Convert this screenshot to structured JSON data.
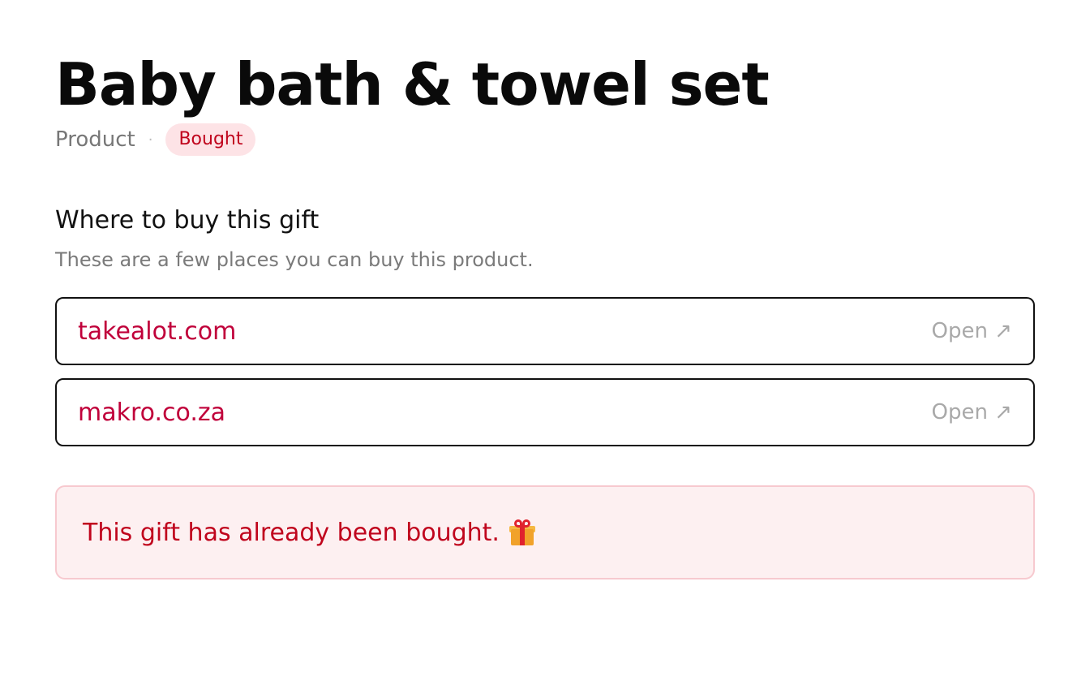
{
  "page": {
    "title": "Baby bath & towel set",
    "type_label": "Product",
    "separator": "·",
    "status_badge": "Bought"
  },
  "where_to_buy": {
    "heading": "Where to buy this gift",
    "subheading": "These are a few places you can buy this product.",
    "stores": [
      {
        "name": "takealot.com",
        "action": "Open ↗"
      },
      {
        "name": "makro.co.za",
        "action": "Open ↗"
      }
    ]
  },
  "notice": {
    "text": "This gift has already been bought.",
    "icon": "gift-icon"
  },
  "colors": {
    "accent": "#c0003a",
    "badge_bg": "#fde3e6",
    "badge_text": "#c0051d",
    "notice_bg": "#fdf0f1",
    "notice_border": "#f7c9cf",
    "muted": "#7a7a7a"
  }
}
